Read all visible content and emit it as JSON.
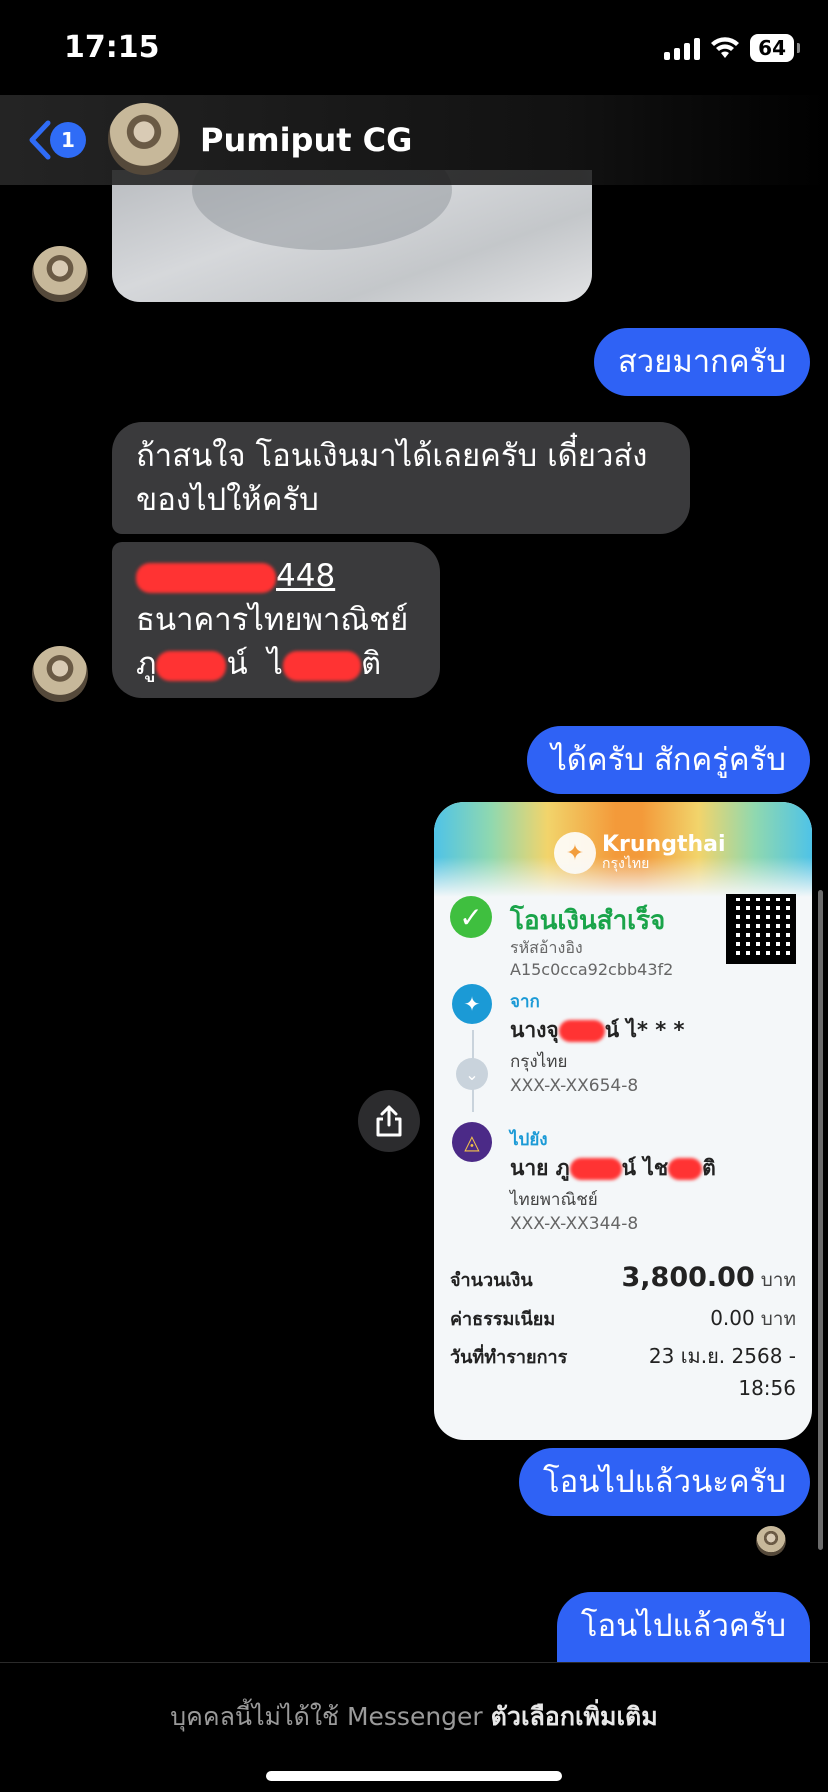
{
  "status_bar": {
    "time": "17:15",
    "battery": "64"
  },
  "header": {
    "back_badge": "1",
    "contact_name": "Pumiput CG"
  },
  "messages": {
    "m1": "สวยมากครับ",
    "m2": "ถ้าสนใจ โอนเงินมาได้เลยครับ เดี๋ยวส่งของไปให้ครับ",
    "m3_account_tail": "448",
    "m3_bank": "ธนาคารไทยพาณิชย์",
    "m3_name_a": "ภู",
    "m3_name_b": "น์",
    "m3_name_c": "ไ",
    "m3_name_d": "ติ",
    "m4": "ได้ครับ สักครู่ครับ",
    "m5": "โอนไปแล้วนะครับ",
    "m6": "โอนไปแล้วครับ"
  },
  "receipt": {
    "brand": "Krungthai",
    "brand_th": "กรุงไทย",
    "status": "โอนเงินสำเร็จ",
    "ref_label": "รหัสอ้างอิง",
    "ref_value": "A15c0cca92cbb43f2",
    "from_label": "จาก",
    "from_name_a": "นางจุ",
    "from_name_b": "น์ ไ* * *",
    "from_bank": "กรุงไทย",
    "from_account": "XXX-X-XX654-8",
    "to_label": "ไปยัง",
    "to_name_a": "นาย ภู",
    "to_name_b": "น์ ไช",
    "to_name_c": "ติ",
    "to_bank": "ไทยพาณิชย์",
    "to_account": "XXX-X-XX344-8",
    "amount_label": "จำนวนเงิน",
    "amount_value": "3,800.00",
    "fee_label": "ค่าธรรมเนียม",
    "fee_value": "0.00",
    "unit": "บาท",
    "date_label": "วันที่ทำรายการ",
    "date_value": "23 เม.ย. 2568 -",
    "time_value": "18:56"
  },
  "footer": {
    "notice": "บุคคลนี้ไม่ได้ใช้ Messenger",
    "more_options": "ตัวเลือกเพิ่มเติม"
  }
}
